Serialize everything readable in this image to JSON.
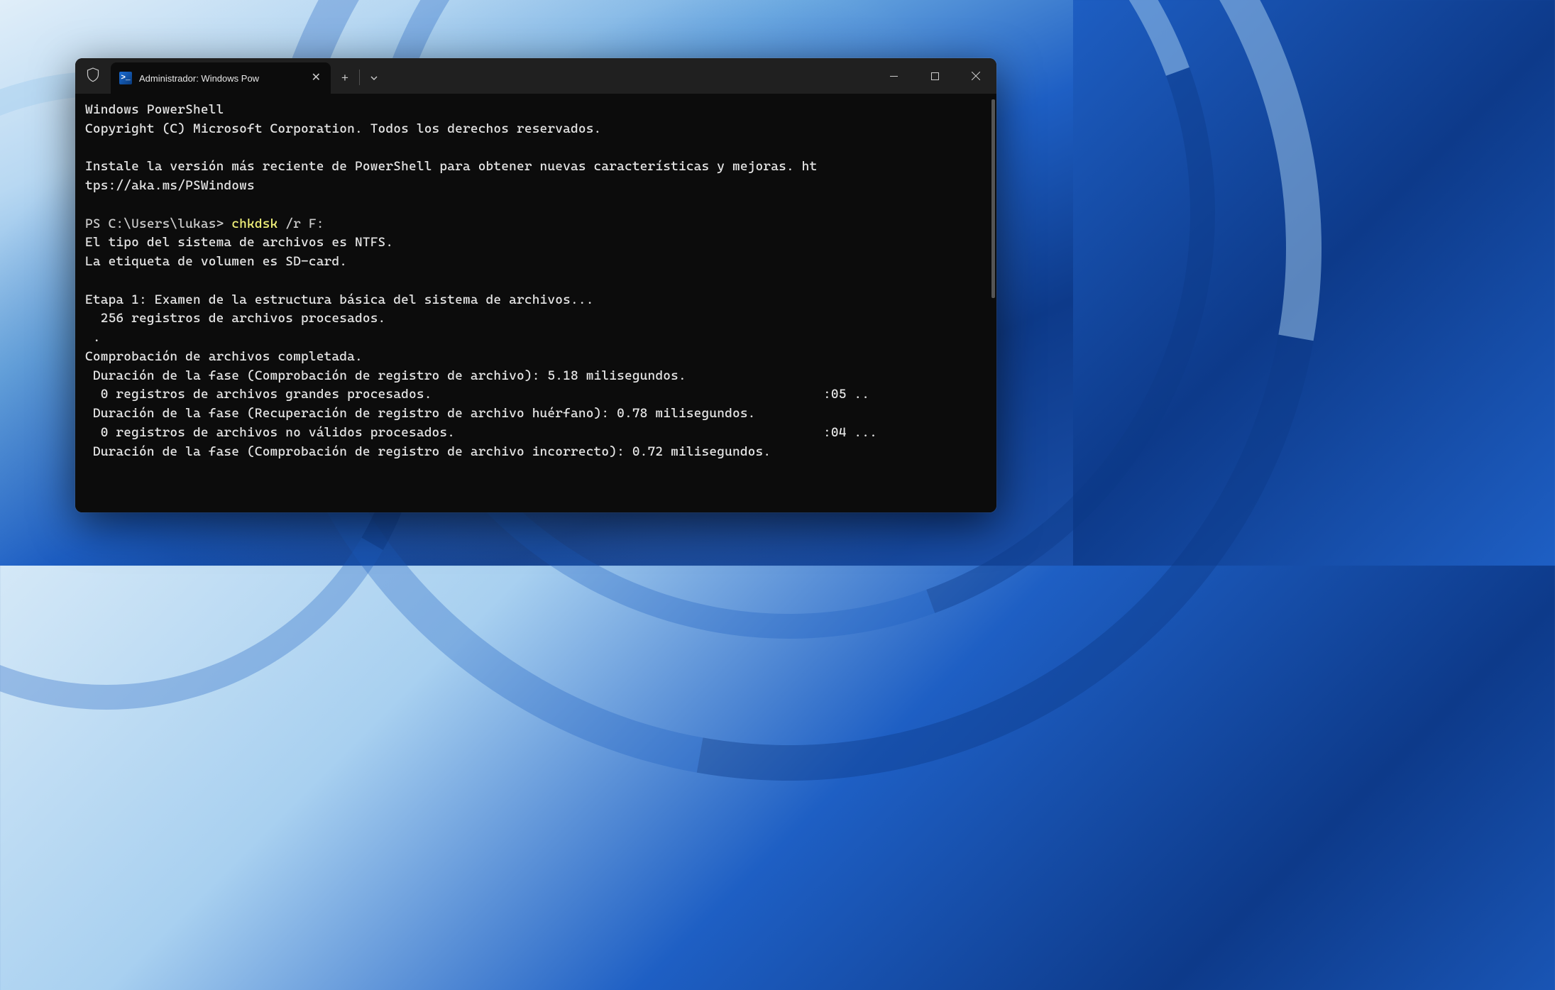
{
  "window": {
    "tab_title": "Administrador: Windows Pow",
    "ps_glyph": ">_"
  },
  "terminal": {
    "line1": "Windows PowerShell",
    "line2": "Copyright (C) Microsoft Corporation. Todos los derechos reservados.",
    "line3": "",
    "line4": "Instale la versión más reciente de PowerShell para obtener nuevas características y mejoras. ht",
    "line5": "tps://aka.ms/PSWindows",
    "line6": "",
    "prompt": "PS C:\\Users\\lukas> ",
    "command": "chkdsk",
    "args": " /r F:",
    "out1": "El tipo del sistema de archivos es NTFS.",
    "out2": "La etiqueta de volumen es SD-card.",
    "out3": "",
    "out4": "Etapa 1: Examen de la estructura básica del sistema de archivos...",
    "out5": "  256 registros de archivos procesados.",
    "out6": " .",
    "out7": "Comprobación de archivos completada.",
    "out8": " Duración de la fase (Comprobación de registro de archivo): 5.18 milisegundos.",
    "out9a": "  0 registros de archivos grandes procesados.",
    "out9b": ":05 ..",
    "out10": " Duración de la fase (Recuperación de registro de archivo huérfano): 0.78 milisegundos.",
    "out11a": "  0 registros de archivos no válidos procesados.",
    "out11b": ":04 ...",
    "out12": " Duración de la fase (Comprobación de registro de archivo incorrecto): 0.72 milisegundos."
  }
}
